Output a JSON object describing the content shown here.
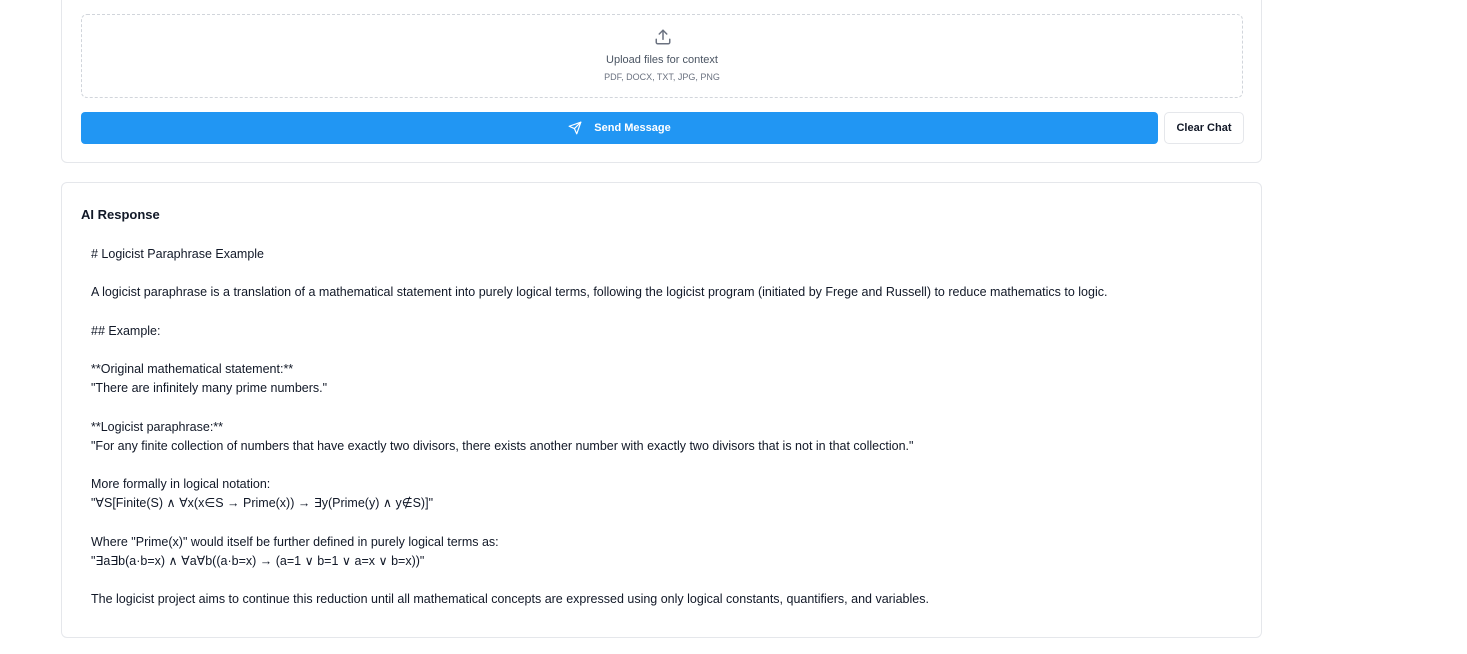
{
  "upload": {
    "icon": "upload-icon",
    "title": "Upload files for context",
    "types": "PDF, DOCX, TXT, JPG, PNG"
  },
  "actions": {
    "send_icon": "send-icon",
    "send_label": "Send Message",
    "clear_label": "Clear Chat"
  },
  "colors": {
    "accent": "#2196f3",
    "border": "#e5e7eb"
  },
  "response": {
    "title": "AI Response",
    "lines": [
      "# Logicist Paraphrase Example",
      "",
      "A logicist paraphrase is a translation of a mathematical statement into purely logical terms, following the logicist program (initiated by Frege and Russell) to reduce mathematics to logic.",
      "",
      "## Example:",
      "",
      "**Original mathematical statement:**",
      "\"There are infinitely many prime numbers.\"",
      "",
      "**Logicist paraphrase:**",
      "\"For any finite collection of numbers that have exactly two divisors, there exists another number with exactly two divisors that is not in that collection.\"",
      "",
      "More formally in logical notation:",
      "\"∀S[Finite(S) ∧ ∀x(x∈S → Prime(x)) → ∃y(Prime(y) ∧ y∉S)]\"",
      "",
      "Where \"Prime(x)\" would itself be further defined in purely logical terms as:",
      "\"∃a∃b(a·b=x) ∧ ∀a∀b((a·b=x) → (a=1 ∨ b=1 ∨ a=x ∨ b=x))\"",
      "",
      "The logicist project aims to continue this reduction until all mathematical concepts are expressed using only logical constants, quantifiers, and variables."
    ]
  }
}
